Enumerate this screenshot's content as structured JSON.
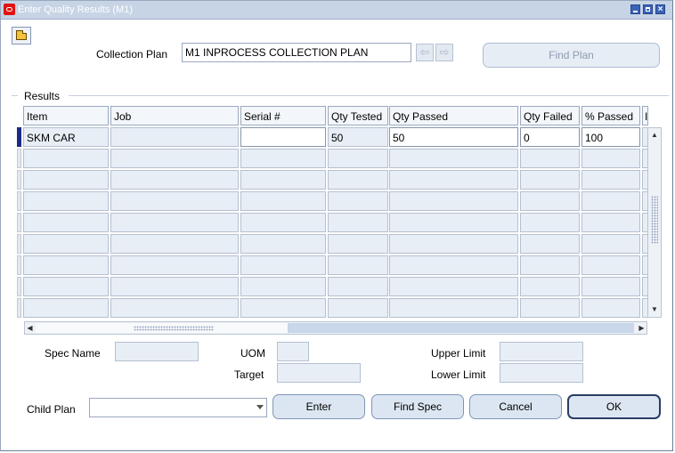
{
  "window": {
    "title": "Enter Quality Results (M1)"
  },
  "header": {
    "collection_plan_label": "Collection Plan",
    "collection_plan_value": "M1 INPROCESS COLLECTION PLAN",
    "find_plan_label": "Find Plan"
  },
  "results": {
    "section_label": "Results",
    "columns": [
      "Item",
      "Job",
      "Serial #",
      "Qty Tested",
      "Qty Passed",
      "Qty Failed",
      "% Passed",
      "I"
    ],
    "rows": [
      {
        "item": "SKM CAR",
        "job": "",
        "serial": "",
        "qty_tested": "50",
        "qty_passed": "50",
        "qty_failed": "0",
        "pct_passed": "100"
      }
    ]
  },
  "spec": {
    "spec_name_label": "Spec Name",
    "uom_label": "UOM",
    "target_label": "Target",
    "upper_limit_label": "Upper Limit",
    "lower_limit_label": "Lower Limit"
  },
  "footer": {
    "child_plan_label": "Child Plan",
    "enter_label": "Enter",
    "find_spec_label": "Find Spec",
    "cancel_label": "Cancel",
    "ok_label": "OK"
  },
  "colors": {
    "title_bar": "#c7d4e5",
    "current_row": "#1b2a86",
    "button": "#dce6f2"
  }
}
